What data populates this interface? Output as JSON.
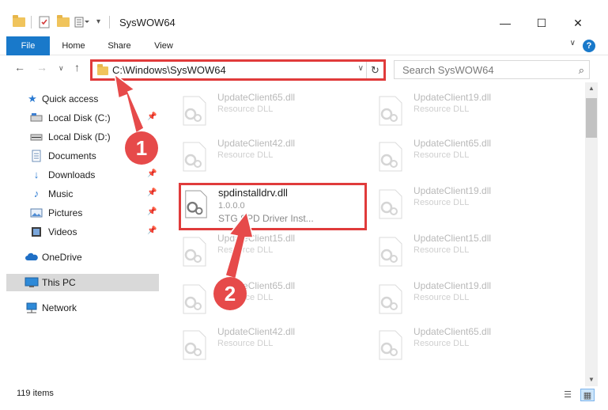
{
  "window": {
    "title": "SysWOW64",
    "minimize": "—",
    "maximize": "☐",
    "close": "✕"
  },
  "ribbon": {
    "tabs": [
      "File",
      "Home",
      "Share",
      "View"
    ],
    "help": "?",
    "collapse": "∨"
  },
  "nav": {
    "back": "←",
    "forward": "→",
    "recent": "∨",
    "up": "↑",
    "address": "C:\\Windows\\SysWOW64",
    "address_dropdown": "∨",
    "refresh": "↻",
    "search_placeholder": "Search SysWOW64",
    "search_icon": "⌕"
  },
  "sidebar": {
    "items": [
      {
        "label": "Quick access",
        "icon": "star-icon"
      },
      {
        "label": "Local Disk (C:)",
        "icon": "drive-icon",
        "pinned": true
      },
      {
        "label": "Local Disk (D:)",
        "icon": "drive-icon",
        "pinned": false
      },
      {
        "label": "Documents",
        "icon": "documents-icon",
        "pinned": true
      },
      {
        "label": "Downloads",
        "icon": "download-icon",
        "pinned": true
      },
      {
        "label": "Music",
        "icon": "music-icon",
        "pinned": true
      },
      {
        "label": "Pictures",
        "icon": "pictures-icon",
        "pinned": true
      },
      {
        "label": "Videos",
        "icon": "videos-icon",
        "pinned": true
      },
      {
        "label": "OneDrive",
        "icon": "cloud-icon"
      },
      {
        "label": "This PC",
        "icon": "computer-icon",
        "selected": true
      },
      {
        "label": "Network",
        "icon": "network-icon"
      }
    ],
    "pin_glyph": "📌"
  },
  "files": {
    "left": [
      {
        "name": "UpdateClient65.dll",
        "desc": "Resource DLL"
      },
      {
        "name": "UpdateClient42.dll",
        "desc": "Resource DLL"
      },
      {
        "name": "spdinstalldrv.dll",
        "version": "1.0.0.0",
        "desc": "STG SPD Driver Inst...",
        "highlight": true
      },
      {
        "name": "UpdateClient15.dll",
        "desc": "Resource DLL"
      },
      {
        "name": "UpdateClient65.dll",
        "desc": "Resource DLL"
      },
      {
        "name": "UpdateClient42.dll",
        "desc": "Resource DLL"
      }
    ],
    "right": [
      {
        "name": "UpdateClient19.dll",
        "desc": "Resource DLL"
      },
      {
        "name": "UpdateClient65.dll",
        "desc": "Resource DLL"
      },
      {
        "name": "UpdateClient19.dll",
        "desc": "Resource DLL"
      },
      {
        "name": "UpdateClient15.dll",
        "desc": "Resource DLL"
      },
      {
        "name": "UpdateClient19.dll",
        "desc": "Resource DLL"
      },
      {
        "name": "UpdateClient65.dll",
        "desc": "Resource DLL"
      }
    ]
  },
  "status": {
    "item_count": "119 items"
  },
  "annotations": {
    "step1": "1",
    "step2": "2"
  },
  "colors": {
    "accent": "#1979ca",
    "highlight_red": "#e03b3b",
    "badge_red": "#e64a4a"
  }
}
